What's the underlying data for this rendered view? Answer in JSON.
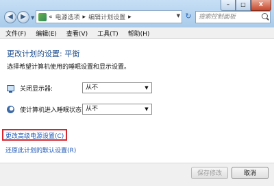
{
  "window": {
    "minimize_symbol": "–",
    "maximize_symbol": "□",
    "close_symbol": "X"
  },
  "nav": {
    "back_symbol": "◀",
    "forward_symbol": "▶",
    "dropdown_symbol": "▼"
  },
  "address": {
    "prefix": "«",
    "crumb1": "电源选项",
    "separator": "▸",
    "crumb2": "编辑计划设置",
    "dropdown_symbol": "▼",
    "refresh_symbol": "↻"
  },
  "search": {
    "placeholder": "搜索控制面板"
  },
  "menu": [
    "文件(F)",
    "编辑(E)",
    "查看(V)",
    "工具(T)",
    "帮助(H)"
  ],
  "page": {
    "title": "更改计划的设置: 平衡",
    "subtitle": "选择希望计算机使用的睡眠设置和显示设置。"
  },
  "settings": {
    "display_label": "关闭显示器:",
    "display_value": "从不",
    "sleep_label": "使计算机进入睡眠状态:",
    "sleep_value": "从不",
    "arrow": "▼"
  },
  "links": {
    "advanced": "更改高级电源设置(C)",
    "restore": "还原此计划的默认设置(R)"
  },
  "buttons": {
    "save": "保存修改",
    "cancel": "取消"
  },
  "colors": {
    "link": "#1e57b5",
    "highlight": "#d8262c",
    "title": "#1f4f8f"
  }
}
